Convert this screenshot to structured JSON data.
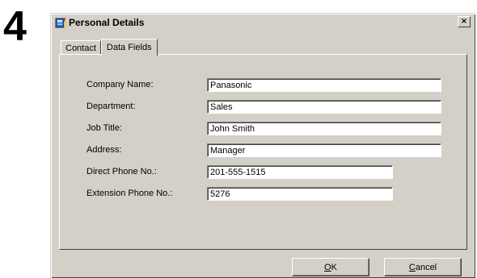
{
  "step": {
    "number": "4"
  },
  "window": {
    "title": "Personal Details",
    "close_glyph": "×",
    "icon": "phonebook-icon"
  },
  "tabs": [
    {
      "label": "Contact",
      "active": false
    },
    {
      "label": "Data Fields",
      "active": true
    }
  ],
  "fields": [
    {
      "label": "Company Name:",
      "value": "Panasonic"
    },
    {
      "label": "Department:",
      "value": "Sales"
    },
    {
      "label": "Job Title:",
      "value": "John Smith"
    },
    {
      "label": "Address:",
      "value": "Manager"
    },
    {
      "label": "Direct Phone No.:",
      "value": "201-555-1515"
    },
    {
      "label": "Extension Phone No.:",
      "value": "5276"
    }
  ],
  "buttons": {
    "ok": {
      "mnemonic": "O",
      "rest": "K"
    },
    "cancel": {
      "mnemonic": "C",
      "rest": "ancel"
    }
  }
}
